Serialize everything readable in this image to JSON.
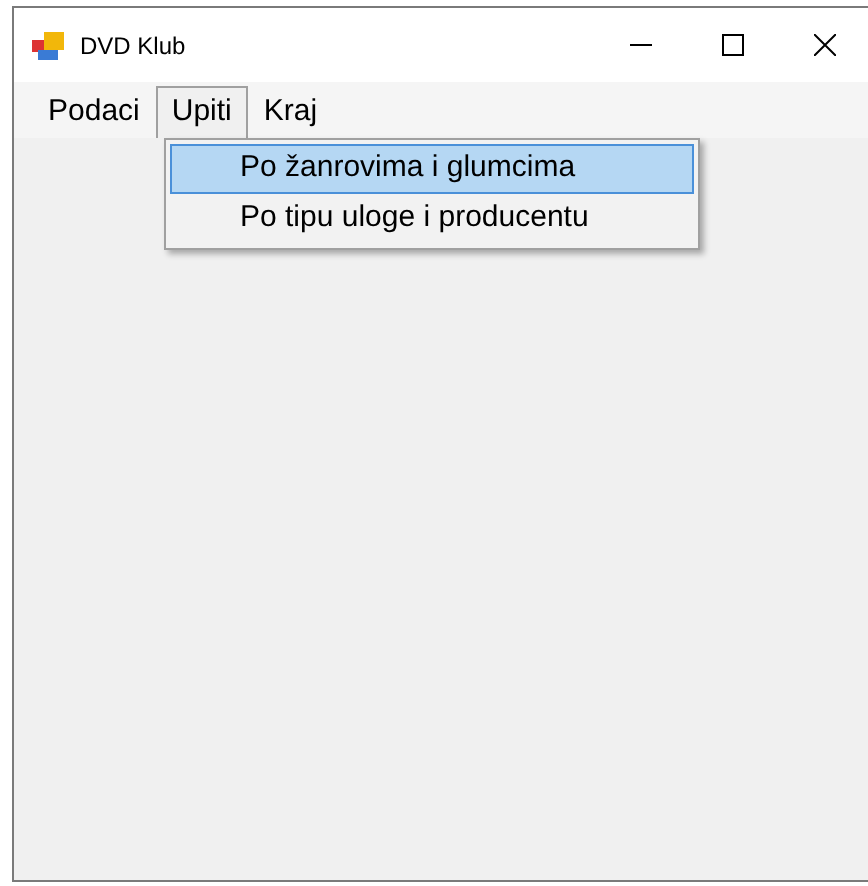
{
  "window": {
    "title": "DVD Klub"
  },
  "menu": [
    {
      "label": "Podaci",
      "selected": false
    },
    {
      "label": "Upiti",
      "selected": true
    },
    {
      "label": "Kraj",
      "selected": false
    }
  ],
  "dropdown": [
    {
      "label": "Po žanrovima i glumcima",
      "selected": true
    },
    {
      "label": "Po tipu uloge i producentu",
      "selected": false
    }
  ]
}
